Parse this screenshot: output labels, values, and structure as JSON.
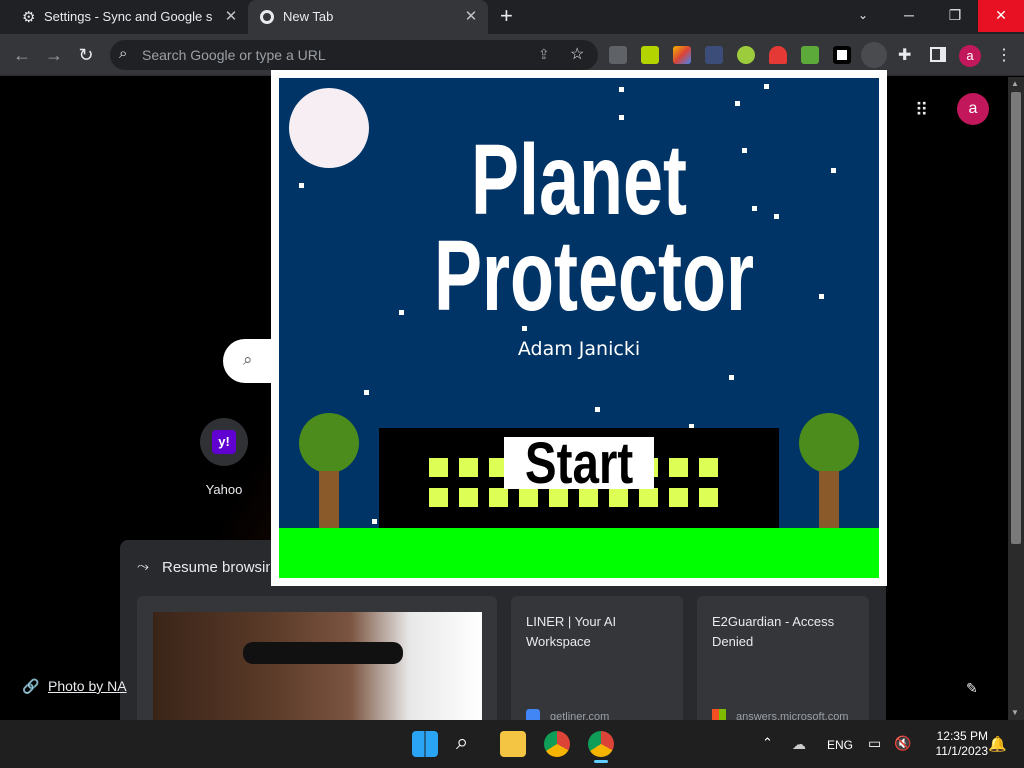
{
  "tabs": [
    {
      "label": "Settings - Sync and Google servi",
      "icon": "gear-icon"
    },
    {
      "label": "New Tab",
      "icon": "chrome-icon"
    }
  ],
  "omnibox": {
    "placeholder": "Search Google or type a URL"
  },
  "profile_initial": "a",
  "game": {
    "title_line1": "Planet",
    "title_line2": "Protector",
    "author": "Adam Janicki",
    "start_label": "Start",
    "colors": {
      "sky": "#003366",
      "ground": "#00ff00",
      "windows": "#ddff55",
      "tree": "#4c8c1c",
      "trunk": "#8a5a2b"
    }
  },
  "ntp": {
    "shortcut_label": "Yahoo",
    "shortcut_icon_text": "y!",
    "resume_label": "Resume browsing",
    "photo_credit": "Photo by NA",
    "cards": [
      {
        "title": "",
        "source": ""
      },
      {
        "title": "LINER | Your AI Workspace",
        "source": "getliner.com"
      },
      {
        "title": "E2Guardian - Access Denied",
        "source": "answers.microsoft.com"
      }
    ]
  },
  "taskbar": {
    "language": "ENG",
    "time": "12:35 PM",
    "date": "11/1/2023"
  }
}
